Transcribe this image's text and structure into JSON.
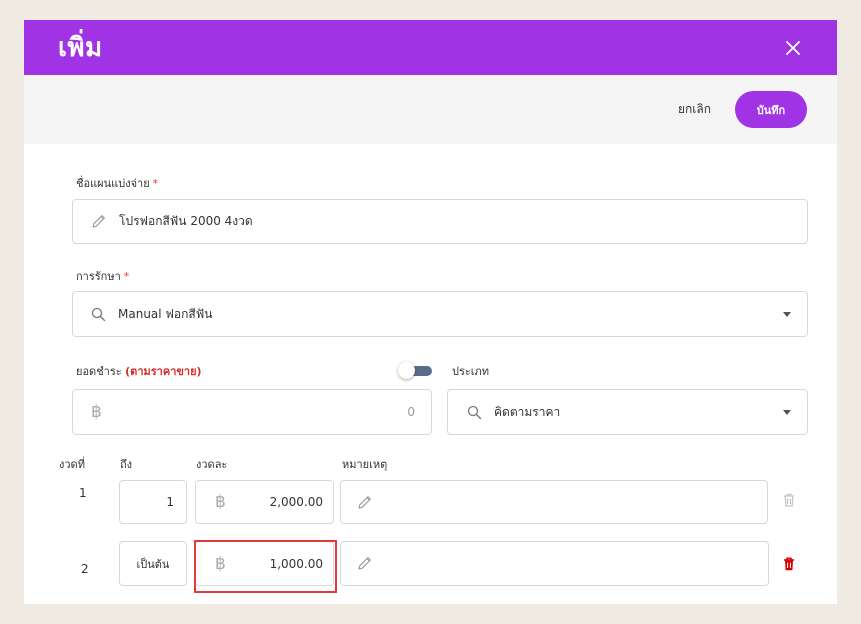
{
  "modal": {
    "title": "เพิ่ม",
    "close_icon": "close-icon"
  },
  "toolbar": {
    "cancel_label": "ยกเลิก",
    "save_label": "บันทึก"
  },
  "form": {
    "plan_name": {
      "label": "ชื่อแผนแบ่งจ่าย",
      "required_mark": "*",
      "value": "โปรฟอกสีฟัน 2000 4งวด",
      "icon": "pencil-icon"
    },
    "treatment": {
      "label": "การรักษา",
      "required_mark": "*",
      "value": "Manual ฟอกสีฟัน",
      "icon": "search-icon"
    },
    "amount": {
      "label": "ยอดชำระ",
      "note": "(ตามราคาขาย)",
      "value": "0",
      "currency_icon": "baht-icon"
    },
    "type": {
      "label": "ประเภท",
      "value": "คิดตามราคา",
      "icon": "search-icon"
    },
    "installments": {
      "headers": {
        "index": "งวดที่",
        "to": "ถึง",
        "amount": "งวดละ",
        "note": "หมายเหตุ"
      },
      "rows": [
        {
          "index": "1",
          "to": "1",
          "amount": "2,000.00",
          "note": "",
          "delete_enabled": false
        },
        {
          "index": "2",
          "to": "เป็นต้น",
          "amount": "1,000.00",
          "note": "",
          "delete_enabled": true
        }
      ]
    }
  },
  "colors": {
    "primary": "#a033e4",
    "required": "#e53935",
    "delete_active": "#d50000",
    "delete_disabled": "#c8c8c8",
    "highlight_box": "#e53935"
  }
}
